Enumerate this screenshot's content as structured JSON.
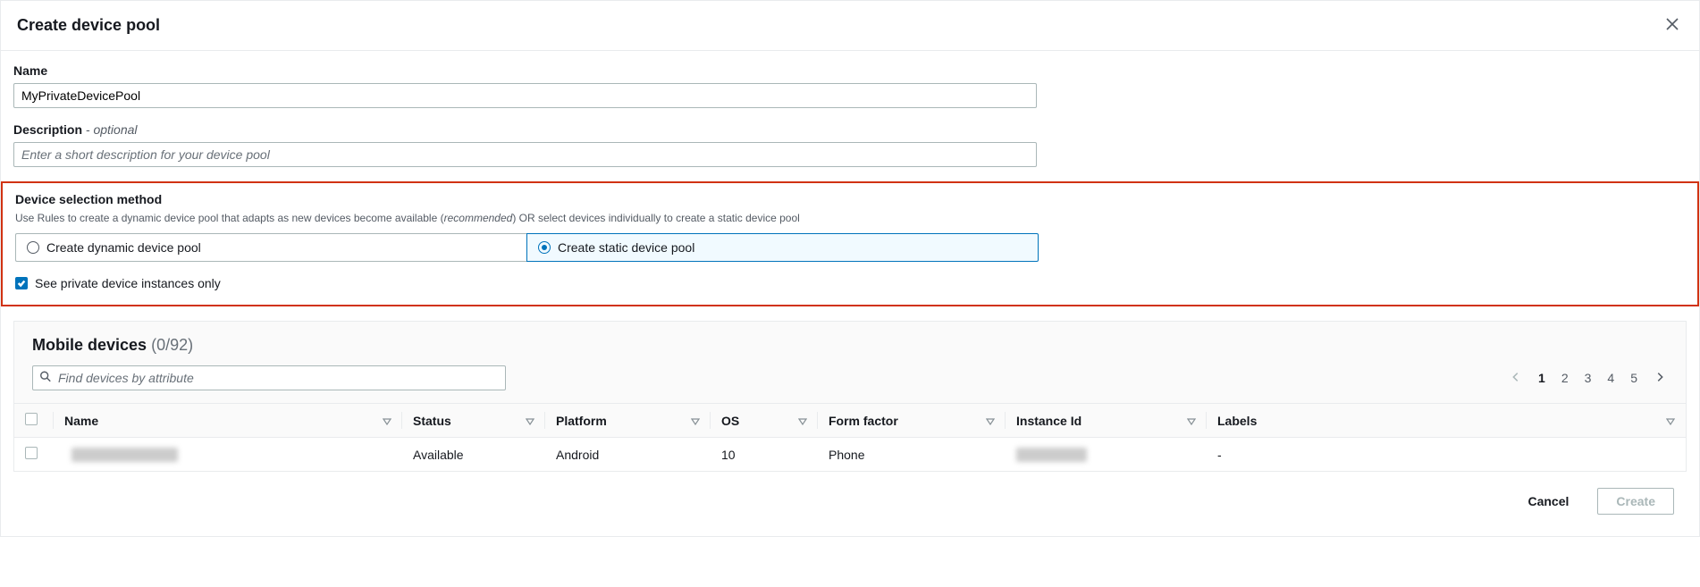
{
  "header": {
    "title": "Create device pool"
  },
  "name_field": {
    "label": "Name",
    "value": "MyPrivateDevicePool"
  },
  "description_field": {
    "label": "Description",
    "optional": "- optional",
    "placeholder": "Enter a short description for your device pool"
  },
  "selection_method": {
    "label": "Device selection method",
    "help_pre": "Use Rules to create a dynamic device pool that adapts as new devices become available (",
    "help_em": "recommended",
    "help_post": ") OR select devices individually to create a static device pool",
    "option_dynamic": "Create dynamic device pool",
    "option_static": "Create static device pool"
  },
  "private_only": {
    "label": "See private device instances only"
  },
  "devices_panel": {
    "title": "Mobile devices",
    "count": "(0/92)",
    "search_placeholder": "Find devices by attribute",
    "pages": [
      "1",
      "2",
      "3",
      "4",
      "5"
    ]
  },
  "table": {
    "columns": {
      "name": "Name",
      "status": "Status",
      "platform": "Platform",
      "os": "OS",
      "form_factor": "Form factor",
      "instance_id": "Instance Id",
      "labels": "Labels"
    },
    "rows": [
      {
        "name": "████████████",
        "status": "Available",
        "platform": "Android",
        "os": "10",
        "form_factor": "Phone",
        "instance_id": "████████",
        "labels": "-"
      }
    ]
  },
  "footer": {
    "cancel": "Cancel",
    "create": "Create"
  }
}
